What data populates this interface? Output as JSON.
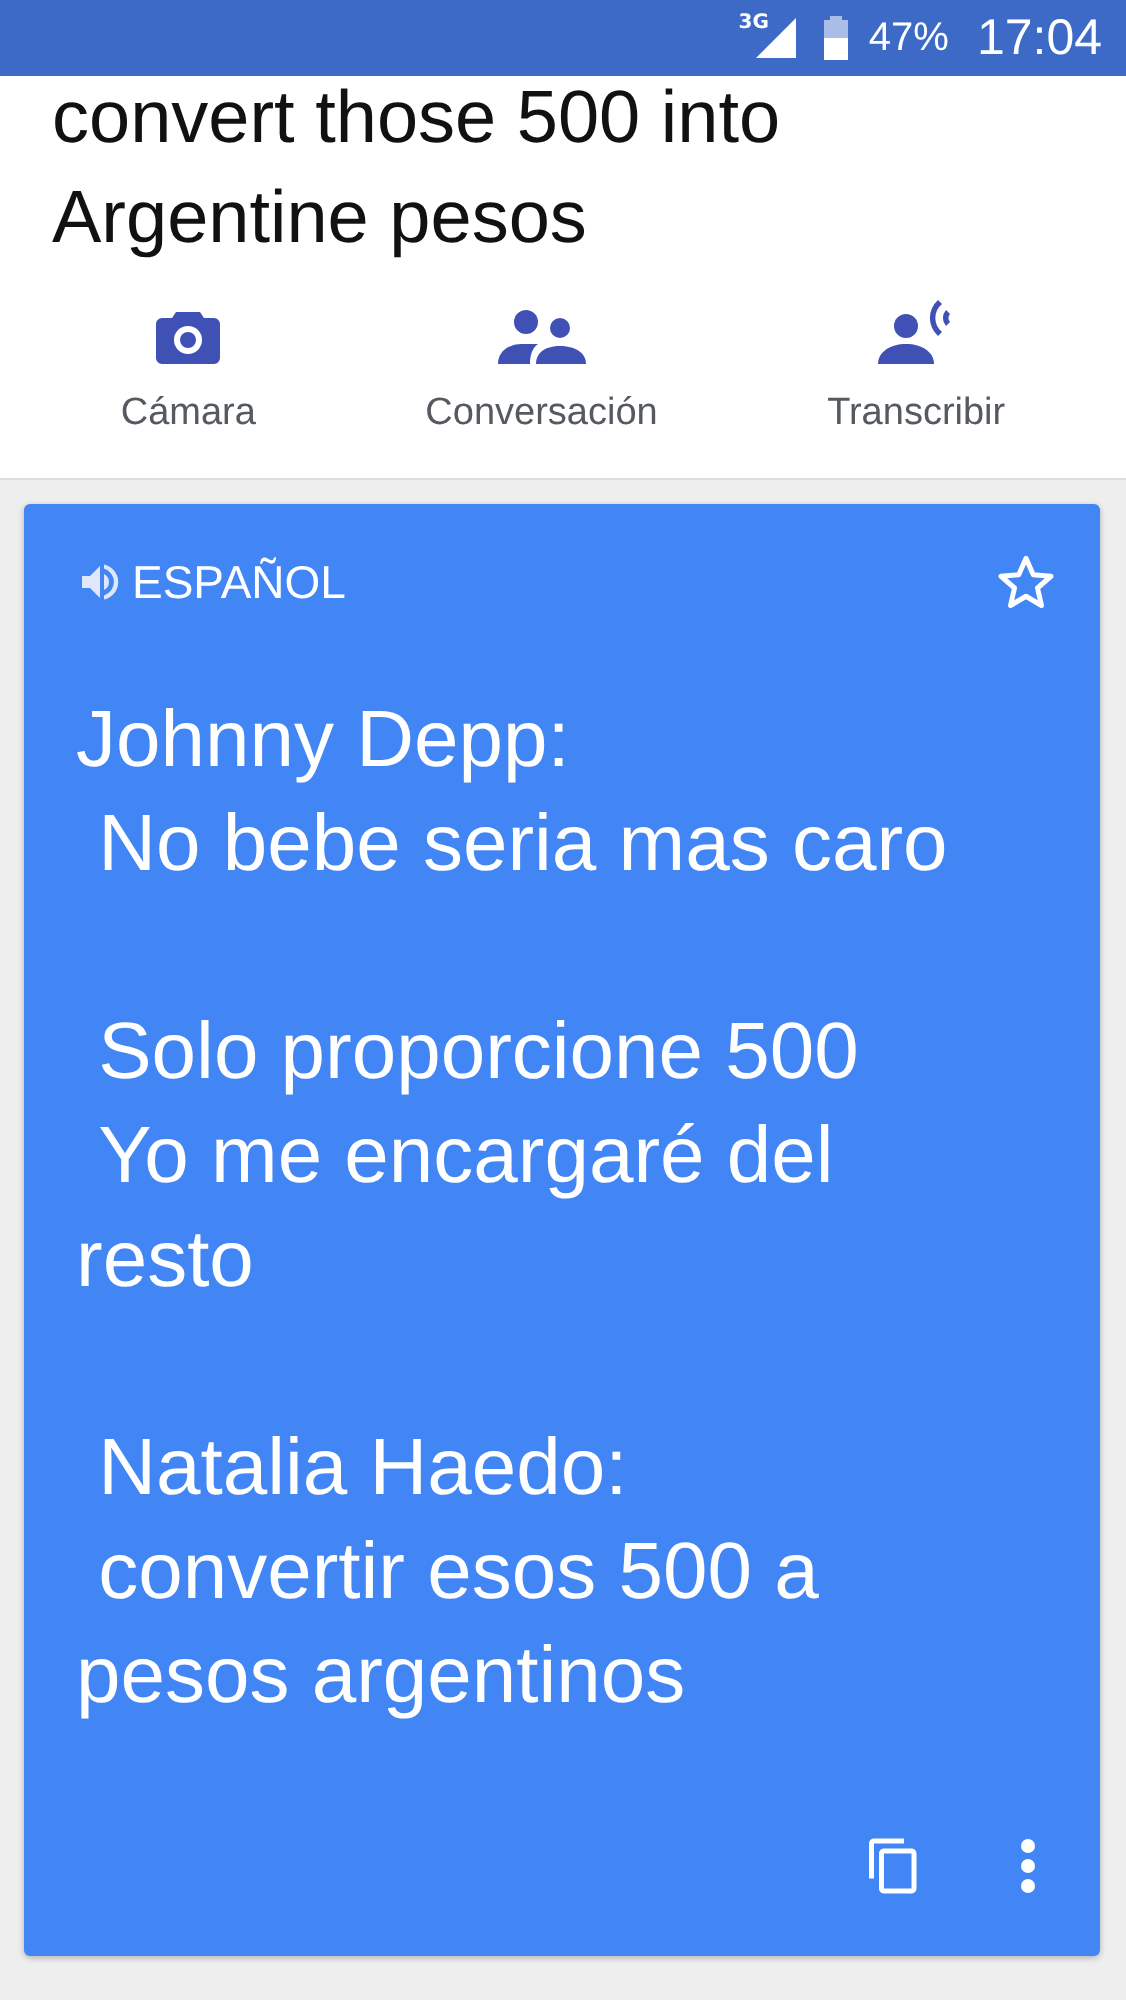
{
  "status_bar": {
    "network": "3G",
    "battery": "47%",
    "time": "17:04"
  },
  "source_text": "convert those 500 into\nArgentine pesos",
  "actions": [
    {
      "label": "Cámara",
      "kind": "camera"
    },
    {
      "label": "Conversación",
      "kind": "conversation"
    },
    {
      "label": "Transcribir",
      "kind": "transcribe"
    }
  ],
  "translation": {
    "language": "ESPAÑOL",
    "starred": false,
    "text": "Johnny Depp:\n No bebe seria mas caro\n\n Solo proporcione 500\n Yo me encargaré del resto\n\n Natalia Haedo:\n convertir esos 500 a pesos argentinos"
  }
}
